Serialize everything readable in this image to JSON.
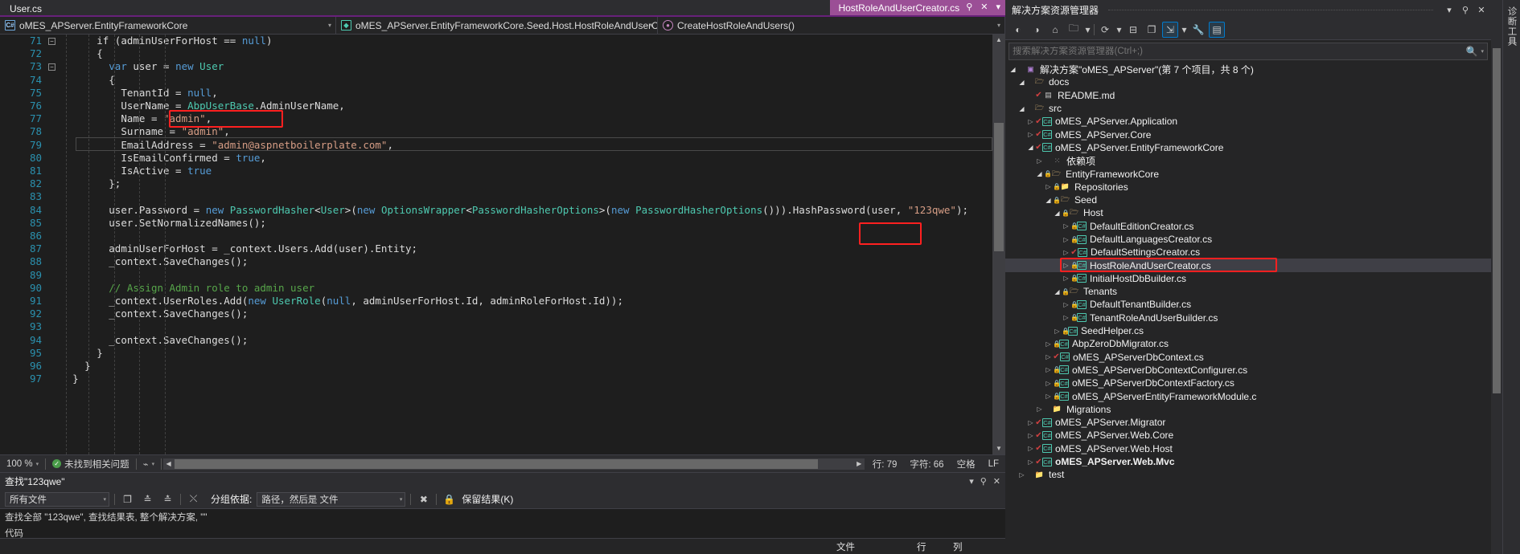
{
  "editor": {
    "tab_inactive_label": "User.cs",
    "tab_active_label": "HostRoleAndUserCreator.cs",
    "tab_pin_icon": "pin-icon",
    "tab_close_icon": "close-icon",
    "tab_menu_icon": "chevron-down-icon",
    "nav": {
      "project": "oMES_APServer.EntityFrameworkCore",
      "type": "oMES_APServer.EntityFrameworkCore.Seed.Host.HostRoleAndUserCreator",
      "member": "CreateHostRoleAndUsers()"
    },
    "code_lines": [
      {
        "num": "71",
        "indent": 8,
        "fold": "minus",
        "tokens": [
          {
            "t": "if (",
            "c": "pl"
          },
          {
            "t": "adminUserForHost",
            "c": "pl"
          },
          {
            "t": " == ",
            "c": "pl"
          },
          {
            "t": "null",
            "c": "kw"
          },
          {
            "t": ")",
            "c": "pl"
          }
        ]
      },
      {
        "num": "72",
        "indent": 8,
        "fold": "",
        "tokens": [
          {
            "t": "{",
            "c": "pl"
          }
        ]
      },
      {
        "num": "73",
        "indent": 10,
        "fold": "minus",
        "tokens": [
          {
            "t": "var",
            "c": "kw"
          },
          {
            "t": " user = ",
            "c": "pl"
          },
          {
            "t": "new",
            "c": "kw"
          },
          {
            "t": " ",
            "c": "pl"
          },
          {
            "t": "User",
            "c": "typ"
          }
        ]
      },
      {
        "num": "74",
        "indent": 10,
        "fold": "",
        "tokens": [
          {
            "t": "{",
            "c": "pl"
          }
        ]
      },
      {
        "num": "75",
        "indent": 12,
        "fold": "",
        "tokens": [
          {
            "t": "TenantId = ",
            "c": "pl"
          },
          {
            "t": "null",
            "c": "kw"
          },
          {
            "t": ",",
            "c": "pl"
          }
        ]
      },
      {
        "num": "76",
        "indent": 12,
        "fold": "",
        "tokens": [
          {
            "t": "UserName = ",
            "c": "pl"
          },
          {
            "t": "AbpUserBase",
            "c": "typ"
          },
          {
            "t": ".AdminUserName,",
            "c": "pl"
          }
        ]
      },
      {
        "num": "77",
        "indent": 12,
        "fold": "",
        "tokens": [
          {
            "t": "Name = ",
            "c": "pl"
          },
          {
            "t": "\"admin\"",
            "c": "str"
          },
          {
            "t": ",",
            "c": "pl"
          }
        ]
      },
      {
        "num": "78",
        "indent": 12,
        "fold": "",
        "tokens": [
          {
            "t": "Surname = ",
            "c": "pl"
          },
          {
            "t": "\"admin\"",
            "c": "str"
          },
          {
            "t": ",",
            "c": "pl"
          }
        ]
      },
      {
        "num": "79",
        "indent": 12,
        "fold": "",
        "tokens": [
          {
            "t": "EmailAddress = ",
            "c": "pl"
          },
          {
            "t": "\"admin@aspnetboilerplate.com\"",
            "c": "str"
          },
          {
            "t": ",",
            "c": "pl"
          }
        ]
      },
      {
        "num": "80",
        "indent": 12,
        "fold": "",
        "tokens": [
          {
            "t": "IsEmailConfirmed = ",
            "c": "pl"
          },
          {
            "t": "true",
            "c": "kw"
          },
          {
            "t": ",",
            "c": "pl"
          }
        ]
      },
      {
        "num": "81",
        "indent": 12,
        "fold": "",
        "tokens": [
          {
            "t": "IsActive = ",
            "c": "pl"
          },
          {
            "t": "true",
            "c": "kw"
          }
        ]
      },
      {
        "num": "82",
        "indent": 10,
        "fold": "",
        "tokens": [
          {
            "t": "};",
            "c": "pl"
          }
        ]
      },
      {
        "num": "83",
        "indent": 0,
        "fold": "",
        "tokens": []
      },
      {
        "num": "84",
        "indent": 10,
        "fold": "",
        "tokens": [
          {
            "t": "user.Password = ",
            "c": "pl"
          },
          {
            "t": "new",
            "c": "kw"
          },
          {
            "t": " ",
            "c": "pl"
          },
          {
            "t": "PasswordHasher",
            "c": "typ"
          },
          {
            "t": "<",
            "c": "pl"
          },
          {
            "t": "User",
            "c": "typ"
          },
          {
            "t": ">(",
            "c": "pl"
          },
          {
            "t": "new",
            "c": "kw"
          },
          {
            "t": " ",
            "c": "pl"
          },
          {
            "t": "OptionsWrapper",
            "c": "typ"
          },
          {
            "t": "<",
            "c": "pl"
          },
          {
            "t": "PasswordHasherOptions",
            "c": "typ"
          },
          {
            "t": ">(",
            "c": "pl"
          },
          {
            "t": "new",
            "c": "kw"
          },
          {
            "t": " ",
            "c": "pl"
          },
          {
            "t": "PasswordHasherOptions",
            "c": "typ"
          },
          {
            "t": "())).HashPassword(user, ",
            "c": "pl"
          },
          {
            "t": "\"123qwe\"",
            "c": "str"
          },
          {
            "t": ");",
            "c": "pl"
          }
        ]
      },
      {
        "num": "85",
        "indent": 10,
        "fold": "",
        "tokens": [
          {
            "t": "user.SetNormalizedNames();",
            "c": "pl"
          }
        ]
      },
      {
        "num": "86",
        "indent": 0,
        "fold": "",
        "tokens": []
      },
      {
        "num": "87",
        "indent": 10,
        "fold": "",
        "tokens": [
          {
            "t": "adminUserForHost = _context.Users.Add(user).Entity;",
            "c": "pl"
          }
        ]
      },
      {
        "num": "88",
        "indent": 10,
        "fold": "",
        "tokens": [
          {
            "t": "_context.SaveChanges();",
            "c": "pl"
          }
        ]
      },
      {
        "num": "89",
        "indent": 0,
        "fold": "",
        "tokens": []
      },
      {
        "num": "90",
        "indent": 10,
        "fold": "",
        "tokens": [
          {
            "t": "// Assign Admin role to admin user",
            "c": "cmt"
          }
        ]
      },
      {
        "num": "91",
        "indent": 10,
        "fold": "",
        "tokens": [
          {
            "t": "_context.UserRoles.Add(",
            "c": "pl"
          },
          {
            "t": "new",
            "c": "kw"
          },
          {
            "t": " ",
            "c": "pl"
          },
          {
            "t": "UserRole",
            "c": "typ"
          },
          {
            "t": "(",
            "c": "pl"
          },
          {
            "t": "null",
            "c": "kw"
          },
          {
            "t": ", adminUserForHost.Id, adminRoleForHost.Id));",
            "c": "pl"
          }
        ]
      },
      {
        "num": "92",
        "indent": 10,
        "fold": "",
        "tokens": [
          {
            "t": "_context.SaveChanges();",
            "c": "pl"
          }
        ]
      },
      {
        "num": "93",
        "indent": 0,
        "fold": "",
        "tokens": []
      },
      {
        "num": "94",
        "indent": 10,
        "fold": "",
        "tokens": [
          {
            "t": "_context.SaveChanges();",
            "c": "pl"
          }
        ]
      },
      {
        "num": "95",
        "indent": 8,
        "fold": "",
        "tokens": [
          {
            "t": "}",
            "c": "pl"
          }
        ]
      },
      {
        "num": "96",
        "indent": 6,
        "fold": "",
        "tokens": [
          {
            "t": "}",
            "c": "pl"
          }
        ]
      },
      {
        "num": "97",
        "indent": 4,
        "fold": "",
        "tokens": [
          {
            "t": "}",
            "c": "pl"
          }
        ]
      }
    ],
    "status": {
      "zoom": "100 %",
      "issues": "未找到相关问题",
      "line_label": "行: 79",
      "col_label": "字符: 66",
      "spaces": "空格",
      "eol": "LF"
    }
  },
  "find_results": {
    "title": "查找\"123qwe\"",
    "scope_value": "所有文件",
    "group_label": "分组依据:",
    "group_value": "路径，然后是 文件",
    "keep_results": "保留结果(K)",
    "summary": "查找全部 \"123qwe\", 查找结果表, 整个解决方案, \"\"",
    "code_label": "代码",
    "columns": [
      "文件",
      "行",
      "列"
    ],
    "icons": {
      "copy": "copy-icon",
      "expand": "expand-all-icon",
      "collapse": "collapse-all-icon",
      "clear": "clear-icon",
      "stop": "stop-icon",
      "lock": "lock-icon",
      "pin": "pin-icon",
      "close": "close-icon"
    }
  },
  "solution_explorer": {
    "title": "解决方案资源管理器",
    "search_placeholder": "搜索解决方案资源管理器(Ctrl+;)",
    "toolbar_icons": [
      "back-icon",
      "forward-icon",
      "home-icon",
      "show-all-files-icon",
      "refresh-icon",
      "collapse-all-icon",
      "properties-icon",
      "sync-icon",
      "preview-icon"
    ],
    "header_icons": [
      "chevron-down-icon",
      "pin-icon",
      "close-icon"
    ],
    "side_tabs": [
      "诊断工具"
    ],
    "tree": [
      {
        "depth": 0,
        "twist": "open",
        "check": "",
        "icon": "sln",
        "label": "解决方案\"oMES_APServer\"(第 7 个项目，共 8 个)",
        "sel": false,
        "bold": false
      },
      {
        "depth": 1,
        "twist": "open",
        "check": "",
        "icon": "folder-open",
        "label": "docs",
        "sel": false,
        "bold": false
      },
      {
        "depth": 2,
        "twist": "",
        "check": "tick",
        "icon": "md",
        "label": "README.md",
        "sel": false,
        "bold": false
      },
      {
        "depth": 1,
        "twist": "open",
        "check": "",
        "icon": "folder-open",
        "label": "src",
        "sel": false,
        "bold": false
      },
      {
        "depth": 2,
        "twist": "closed",
        "check": "tick",
        "icon": "cs",
        "label": "oMES_APServer.Application",
        "sel": false,
        "bold": false
      },
      {
        "depth": 2,
        "twist": "closed",
        "check": "tick",
        "icon": "cs",
        "label": "oMES_APServer.Core",
        "sel": false,
        "bold": false
      },
      {
        "depth": 2,
        "twist": "open",
        "check": "tick",
        "icon": "cs",
        "label": "oMES_APServer.EntityFrameworkCore",
        "sel": false,
        "bold": false
      },
      {
        "depth": 3,
        "twist": "closed",
        "check": "",
        "icon": "dep",
        "label": "依赖项",
        "sel": false,
        "bold": false
      },
      {
        "depth": 3,
        "twist": "open",
        "check": "lock",
        "icon": "folder-open",
        "label": "EntityFrameworkCore",
        "sel": false,
        "bold": false
      },
      {
        "depth": 4,
        "twist": "closed",
        "check": "lock",
        "icon": "folder",
        "label": "Repositories",
        "sel": false,
        "bold": false
      },
      {
        "depth": 4,
        "twist": "open",
        "check": "lock",
        "icon": "folder-open",
        "label": "Seed",
        "sel": false,
        "bold": false
      },
      {
        "depth": 5,
        "twist": "open",
        "check": "lock",
        "icon": "folder-open",
        "label": "Host",
        "sel": false,
        "bold": false
      },
      {
        "depth": 6,
        "twist": "closed",
        "check": "lock",
        "icon": "cs",
        "label": "DefaultEditionCreator.cs",
        "sel": false,
        "bold": false
      },
      {
        "depth": 6,
        "twist": "closed",
        "check": "lock",
        "icon": "cs",
        "label": "DefaultLanguagesCreator.cs",
        "sel": false,
        "bold": false
      },
      {
        "depth": 6,
        "twist": "closed",
        "check": "tick",
        "icon": "cs",
        "label": "DefaultSettingsCreator.cs",
        "sel": false,
        "bold": false
      },
      {
        "depth": 6,
        "twist": "closed",
        "check": "lock",
        "icon": "cs",
        "label": "HostRoleAndUserCreator.cs",
        "sel": true,
        "bold": false
      },
      {
        "depth": 6,
        "twist": "closed",
        "check": "lock",
        "icon": "cs",
        "label": "InitialHostDbBuilder.cs",
        "sel": false,
        "bold": false
      },
      {
        "depth": 5,
        "twist": "open",
        "check": "lock",
        "icon": "folder-open",
        "label": "Tenants",
        "sel": false,
        "bold": false
      },
      {
        "depth": 6,
        "twist": "closed",
        "check": "lock",
        "icon": "cs",
        "label": "DefaultTenantBuilder.cs",
        "sel": false,
        "bold": false
      },
      {
        "depth": 6,
        "twist": "closed",
        "check": "lock",
        "icon": "cs",
        "label": "TenantRoleAndUserBuilder.cs",
        "sel": false,
        "bold": false
      },
      {
        "depth": 5,
        "twist": "closed",
        "check": "lock",
        "icon": "cs",
        "label": "SeedHelper.cs",
        "sel": false,
        "bold": false
      },
      {
        "depth": 4,
        "twist": "closed",
        "check": "lock",
        "icon": "cs",
        "label": "AbpZeroDbMigrator.cs",
        "sel": false,
        "bold": false
      },
      {
        "depth": 4,
        "twist": "closed",
        "check": "tick",
        "icon": "cs",
        "label": "oMES_APServerDbContext.cs",
        "sel": false,
        "bold": false
      },
      {
        "depth": 4,
        "twist": "closed",
        "check": "lock",
        "icon": "cs",
        "label": "oMES_APServerDbContextConfigurer.cs",
        "sel": false,
        "bold": false
      },
      {
        "depth": 4,
        "twist": "closed",
        "check": "lock",
        "icon": "cs",
        "label": "oMES_APServerDbContextFactory.cs",
        "sel": false,
        "bold": false
      },
      {
        "depth": 4,
        "twist": "closed",
        "check": "lock",
        "icon": "cs",
        "label": "oMES_APServerEntityFrameworkModule.c",
        "sel": false,
        "bold": false
      },
      {
        "depth": 3,
        "twist": "closed",
        "check": "",
        "icon": "folder",
        "label": "Migrations",
        "sel": false,
        "bold": false
      },
      {
        "depth": 2,
        "twist": "closed",
        "check": "tick",
        "icon": "cs",
        "label": "oMES_APServer.Migrator",
        "sel": false,
        "bold": false
      },
      {
        "depth": 2,
        "twist": "closed",
        "check": "tick",
        "icon": "cs",
        "label": "oMES_APServer.Web.Core",
        "sel": false,
        "bold": false
      },
      {
        "depth": 2,
        "twist": "closed",
        "check": "tick",
        "icon": "cs",
        "label": "oMES_APServer.Web.Host",
        "sel": false,
        "bold": false
      },
      {
        "depth": 2,
        "twist": "closed",
        "check": "tick",
        "icon": "cs",
        "label": "oMES_APServer.Web.Mvc",
        "sel": false,
        "bold": true
      },
      {
        "depth": 1,
        "twist": "closed",
        "check": "",
        "icon": "folder",
        "label": "test",
        "sel": false,
        "bold": false
      }
    ]
  },
  "colors": {
    "accent_purple": "#9b4f96",
    "annotation_red": "#ff2020",
    "editor_bg": "#1e1e1e",
    "chrome_bg": "#2d2d30"
  }
}
